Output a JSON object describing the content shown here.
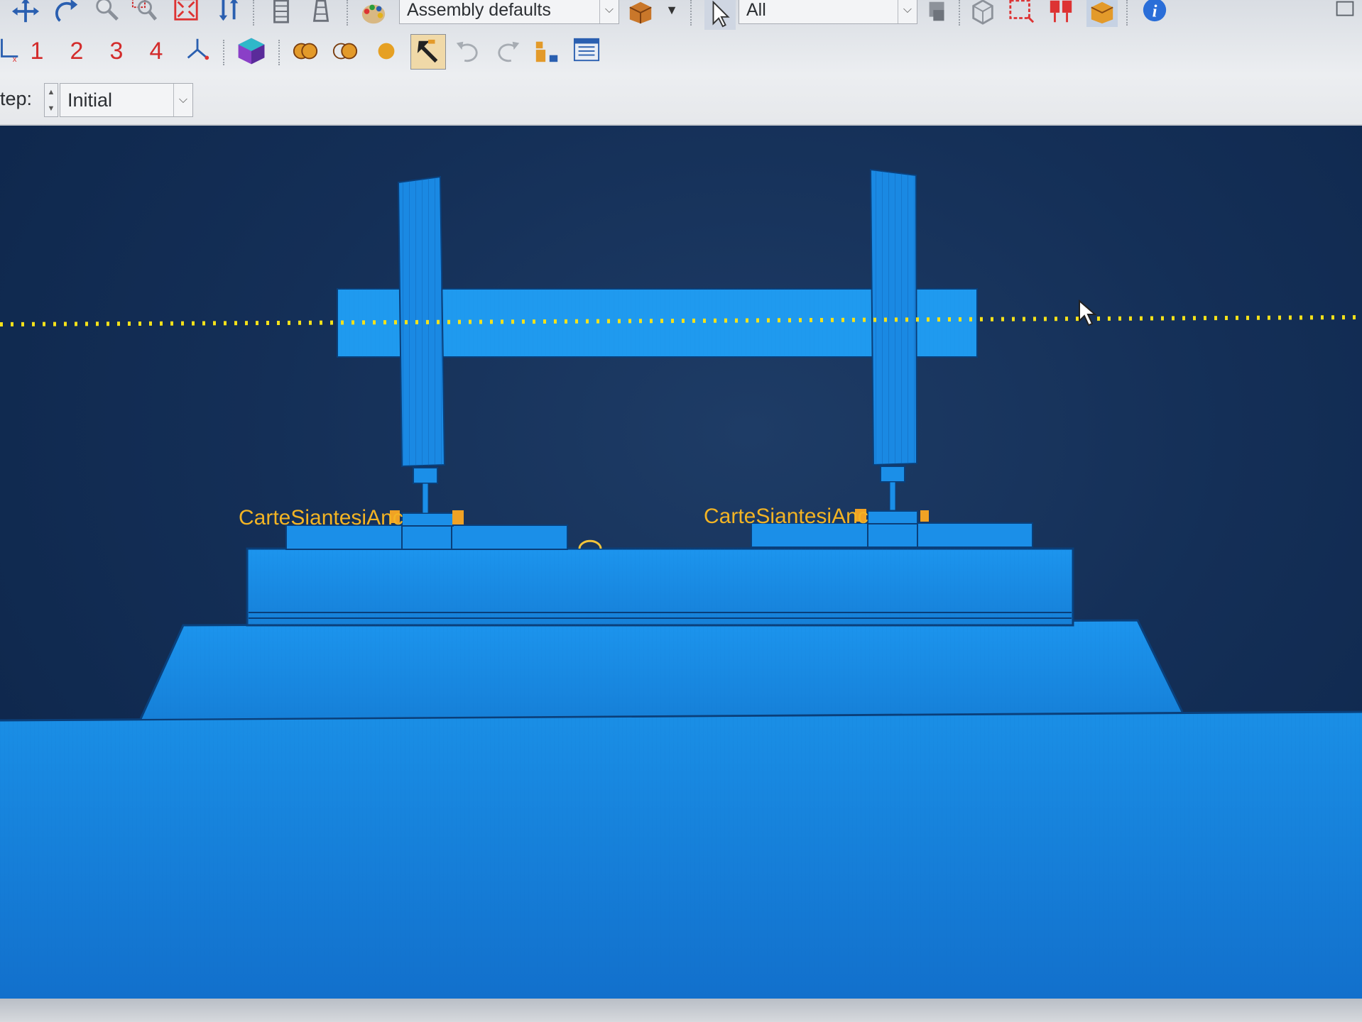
{
  "toolbar": {
    "render_style_combo": {
      "value": "Assembly defaults"
    },
    "selection_filter_combo": {
      "value": "All"
    },
    "view_buttons": [
      "1",
      "2",
      "3",
      "4"
    ],
    "icons": {
      "pan": "pan-icon",
      "rotate": "rotate-icon",
      "zoom": "zoom-icon",
      "box_zoom": "box-zoom-icon",
      "auto_fit": "auto-fit-icon",
      "cycle_views": "cycle-views-icon",
      "render_model": "render-model-icon",
      "query": "query-icon",
      "info": "info-icon"
    }
  },
  "step_selector": {
    "label": "tep:",
    "value": "Initial"
  },
  "viewport": {
    "labels": {
      "left_csys": "CarteSiantesiAnc",
      "right_csys": "CarteSiantesiAnc"
    },
    "colors": {
      "model_blue": "#1a8fe6",
      "model_edge": "#0a3f7a",
      "background": "#142f57",
      "axis_line": "#f5e21a",
      "label_color": "#f3b424"
    }
  }
}
